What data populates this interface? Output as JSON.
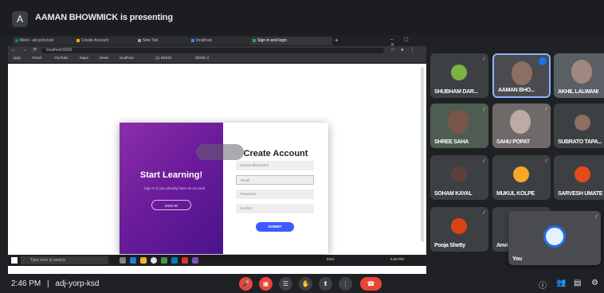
{
  "presenting_bar": {
    "presenter_initial": "A",
    "text": "AAMAN BHOWMICK is presenting"
  },
  "browser": {
    "tabs": [
      {
        "label": "Meet - ad-yorp-ksd",
        "active": false
      },
      {
        "label": "Create Account",
        "active": false
      },
      {
        "label": "New Tab",
        "active": false
      },
      {
        "label": "localhost",
        "active": false
      },
      {
        "label": "Sign in and login",
        "active": true
      }
    ],
    "url": "localhost:5500",
    "bookmarks": [
      "Apps",
      "Gmail",
      "YouTube",
      "Maps",
      "News",
      "localhost",
      "(1) DEMO",
      "DEMO 2"
    ]
  },
  "webpage": {
    "left_title": "Start Learning!",
    "left_subtitle": "Sign In If you already have an account",
    "signin_label": "SIGN IN",
    "right_title": "Create Account",
    "fields": [
      {
        "placeholder": "Aaman Bhowmick"
      },
      {
        "placeholder": "Email"
      },
      {
        "placeholder": "Password"
      },
      {
        "placeholder": "Confirm"
      }
    ],
    "submit_label": "SUBMIT"
  },
  "taskbar": {
    "search_placeholder": "Type here to search",
    "tray_text": "ENG",
    "time": "6:46 PM"
  },
  "participants": [
    {
      "name": "SHUBHAM DAR...",
      "type": "avatar",
      "color": "#7cb342"
    },
    {
      "name": "AAMAN BHO...",
      "type": "video",
      "highlight": true
    },
    {
      "name": "AKHIL LALWANI",
      "type": "video"
    },
    {
      "name": "SHREE SAHA",
      "type": "video"
    },
    {
      "name": "SAHU POPAT",
      "type": "video"
    },
    {
      "name": "SUBRATO TAPA...",
      "type": "avatar",
      "color": "#8d6e63"
    },
    {
      "name": "SOHAM KAYAL",
      "type": "avatar",
      "color": "#5d4037"
    },
    {
      "name": "MUKUL KOLPE",
      "type": "avatar",
      "color": "#f9a825"
    },
    {
      "name": "SARVESH UMATE",
      "type": "avatar",
      "color": "#e64a19"
    },
    {
      "name": "Pooja Shetty",
      "type": "avatar",
      "color": "#d84315"
    },
    {
      "name": "Anvi",
      "type": "avatar",
      "color": "#6d4c41"
    }
  ],
  "self_view": {
    "name": "You"
  },
  "meeting": {
    "time": "2:46 PM",
    "separator": "|",
    "code": "adj-yorp-ksd"
  },
  "colors": {
    "accent_red": "#ea4335",
    "purple": "#6a1b9a",
    "submit_blue": "#3d5afe",
    "meet_bg": "#202124"
  }
}
